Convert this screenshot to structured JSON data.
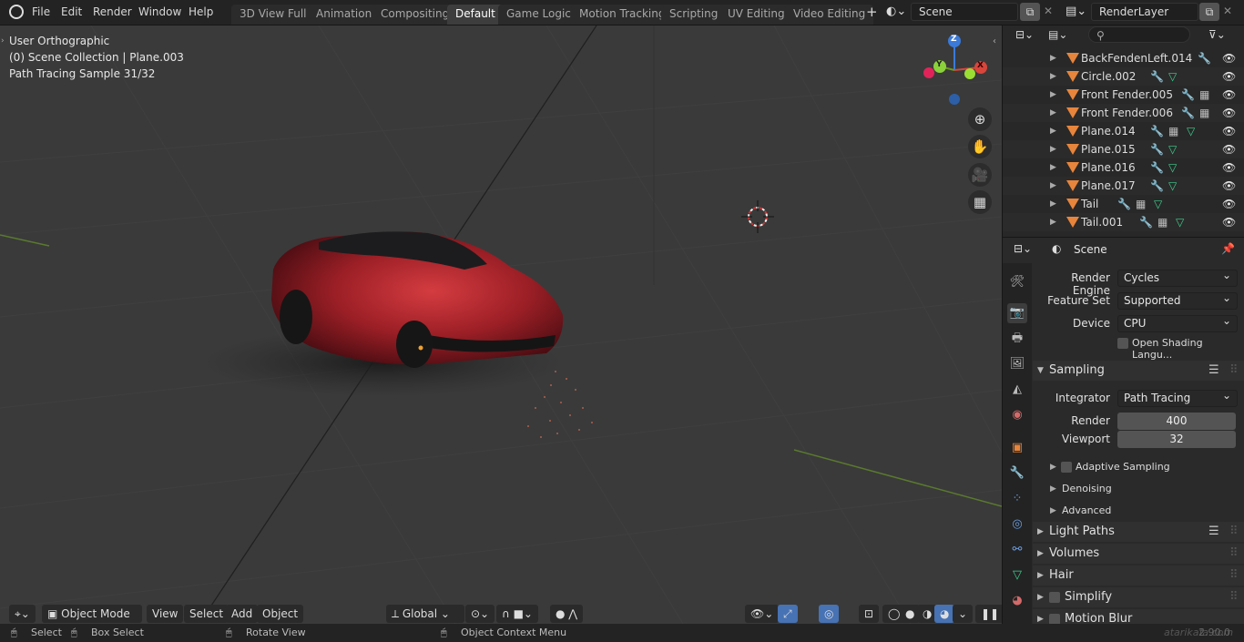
{
  "topbar": {
    "menus": [
      "File",
      "Edit",
      "Render",
      "Window",
      "Help"
    ],
    "workspaces": [
      "3D View Full",
      "Animation",
      "Compositing",
      "Default",
      "Game Logic",
      "Motion Tracking",
      "Scripting",
      "UV Editing",
      "Video Editing"
    ],
    "active_workspace": "Default",
    "add_tab": "+",
    "scene_name": "Scene",
    "view_layer": "RenderLayer"
  },
  "viewport": {
    "view_name": "User Orthographic",
    "collection_info": "(0) Scene Collection | Plane.003",
    "render_status": "Path Tracing Sample 31/32",
    "gizmo_axes": {
      "z": "Z",
      "y": "Y",
      "x": "X"
    },
    "header": {
      "mode": "Object Mode",
      "menus": [
        "View",
        "Select",
        "Add",
        "Object"
      ],
      "transform_orientation": "Global"
    }
  },
  "statusbar": {
    "select": "Select",
    "box_select": "Box Select",
    "rotate_view": "Rotate View",
    "context_menu": "Object Context Menu",
    "version": "2.90.0",
    "watermark": "atarikafa.com"
  },
  "outliner": {
    "items": [
      {
        "name": "BackFendenLeft.014"
      },
      {
        "name": "Circle.002"
      },
      {
        "name": "Front Fender.005"
      },
      {
        "name": "Front Fender.006"
      },
      {
        "name": "Plane.014"
      },
      {
        "name": "Plane.015"
      },
      {
        "name": "Plane.016"
      },
      {
        "name": "Plane.017"
      },
      {
        "name": "Tail"
      },
      {
        "name": "Tail.001"
      }
    ]
  },
  "properties": {
    "context": "Scene",
    "render_engine_label": "Render Engine",
    "render_engine": "Cycles",
    "feature_set_label": "Feature Set",
    "feature_set": "Supported",
    "device_label": "Device",
    "device": "CPU",
    "osl_label": "Open Shading Langu...",
    "sampling_title": "Sampling",
    "integrator_label": "Integrator",
    "integrator": "Path Tracing",
    "render_label": "Render",
    "render_samples": "400",
    "viewport_label": "Viewport",
    "viewport_samples": "32",
    "adaptive_sampling": "Adaptive Sampling",
    "denoising": "Denoising",
    "advanced": "Advanced",
    "light_paths": "Light Paths",
    "volumes": "Volumes",
    "hair": "Hair",
    "simplify": "Simplify",
    "motion_blur": "Motion Blur"
  },
  "colors": {
    "accent_orange": "#e7853c",
    "modifier_blue": "#6c9de0",
    "mesh_green": "#3ecf8e",
    "viewport_bg": "#3a3a3a",
    "car_red": "#b0202a"
  }
}
